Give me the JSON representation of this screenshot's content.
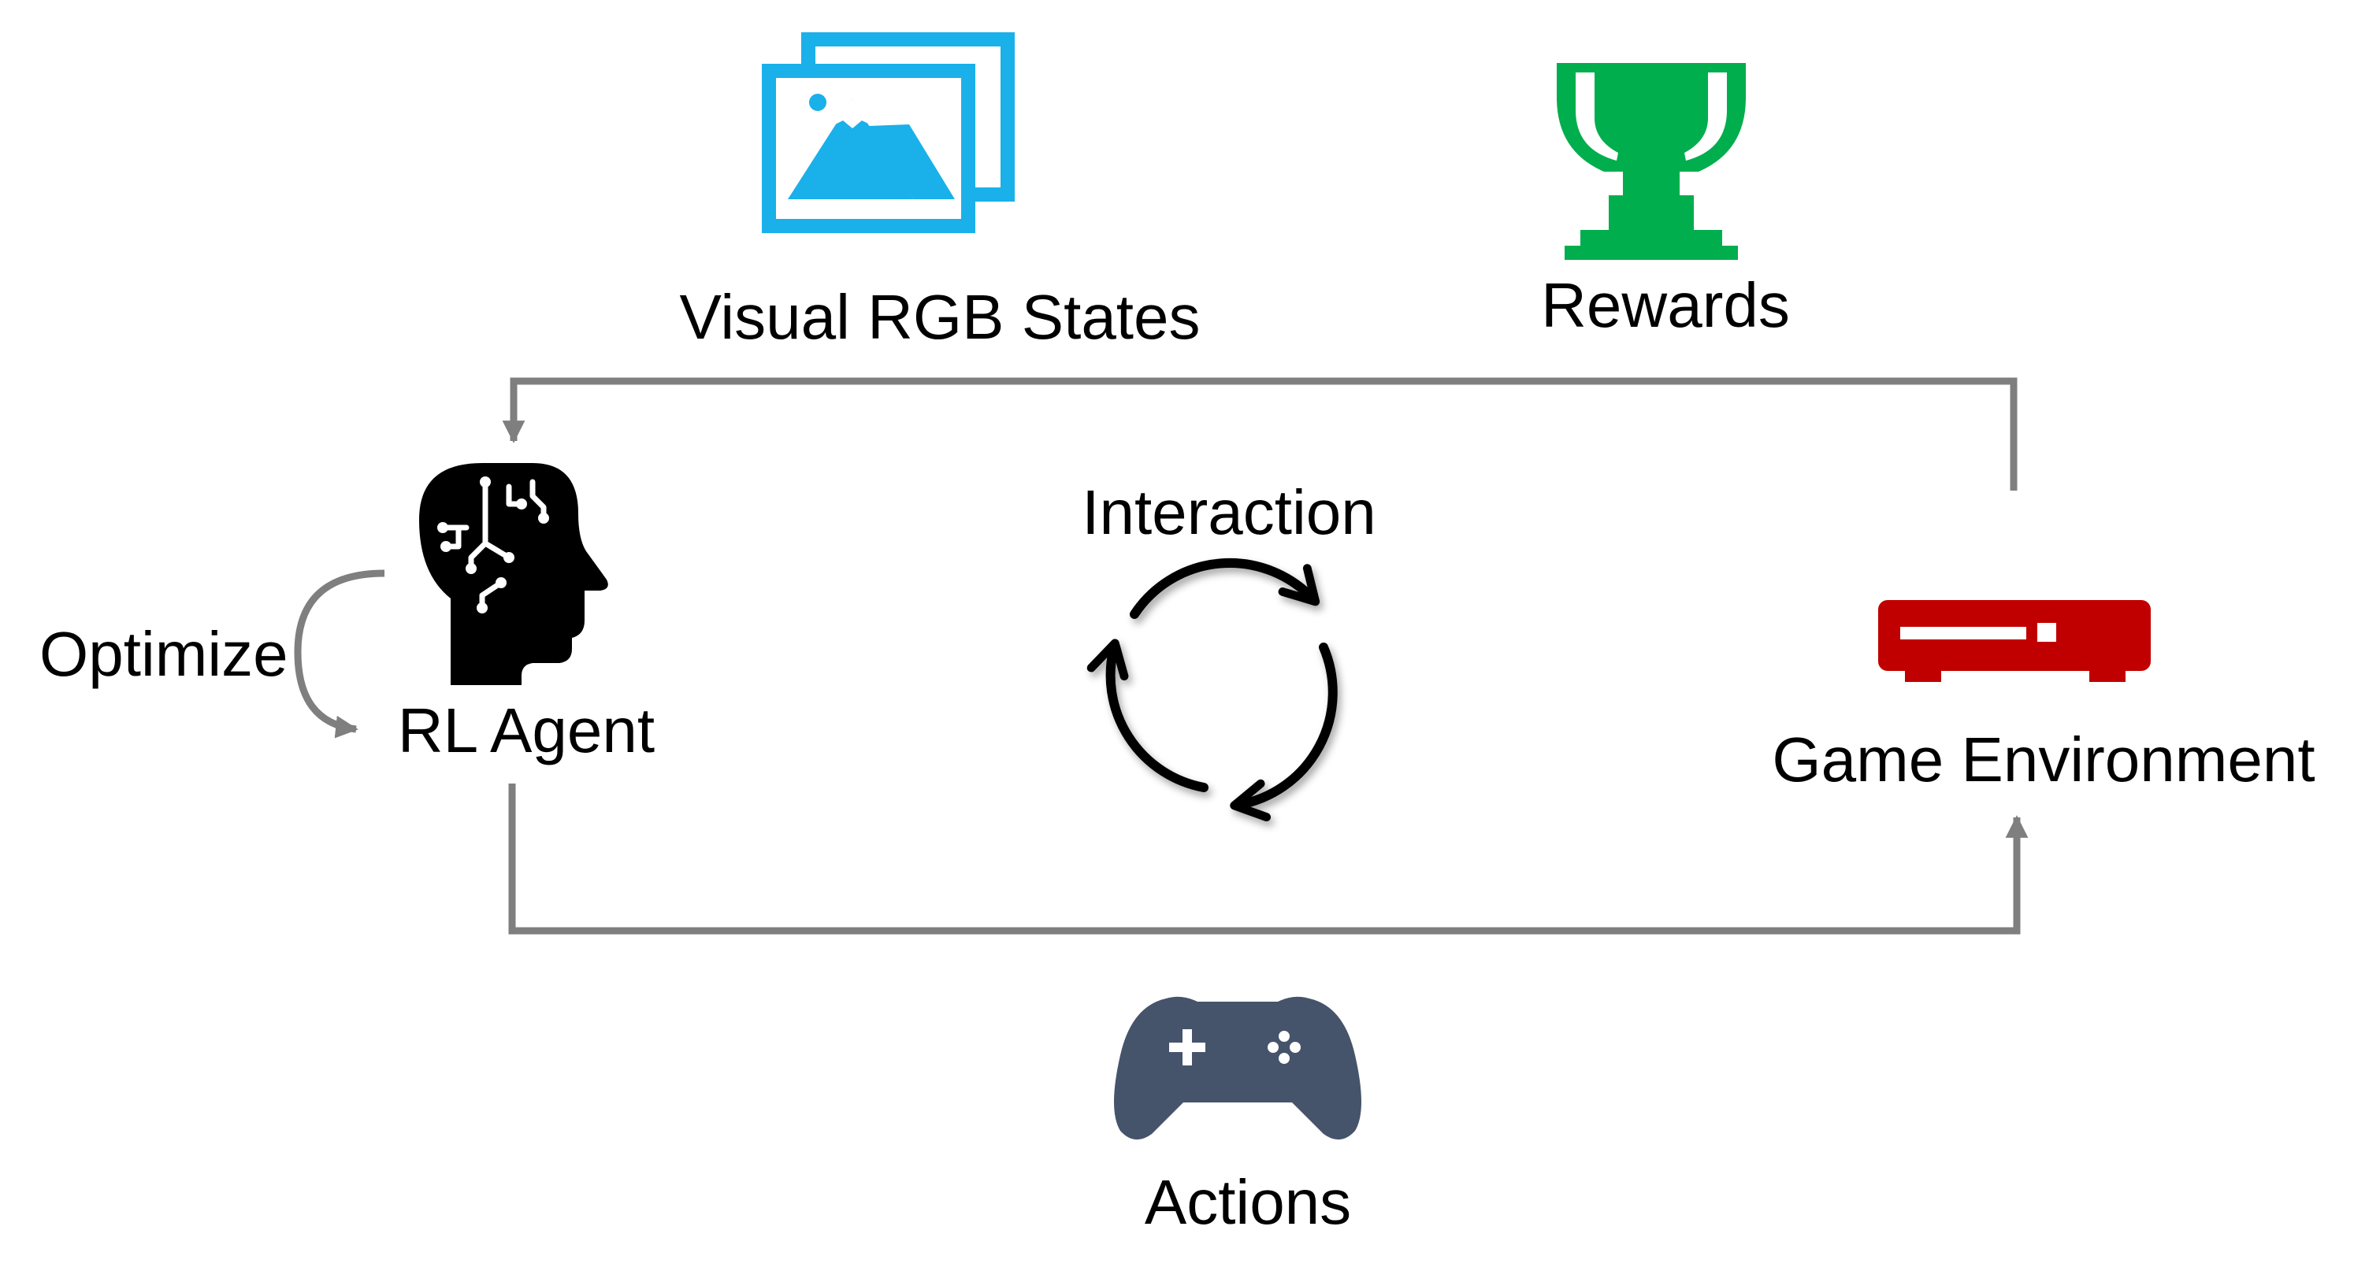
{
  "labels": {
    "visual_states": "Visual RGB States",
    "rewards": "Rewards",
    "interaction": "Interaction",
    "optimize": "Optimize",
    "agent": "RL Agent",
    "environment": "Game Environment",
    "actions": "Actions"
  },
  "icons": {
    "visual_states": "image-gallery-icon",
    "rewards": "trophy-icon",
    "agent": "ai-brain-head-icon",
    "interaction": "cycle-arrows-icon",
    "environment": "game-console-icon",
    "actions": "gamepad-icon"
  },
  "colors": {
    "visual_states": "#1AB0EA",
    "rewards": "#00AE4D",
    "agent": "#000000",
    "environment": "#C00000",
    "actions": "#45546A",
    "connector": "#7F7F7F"
  }
}
